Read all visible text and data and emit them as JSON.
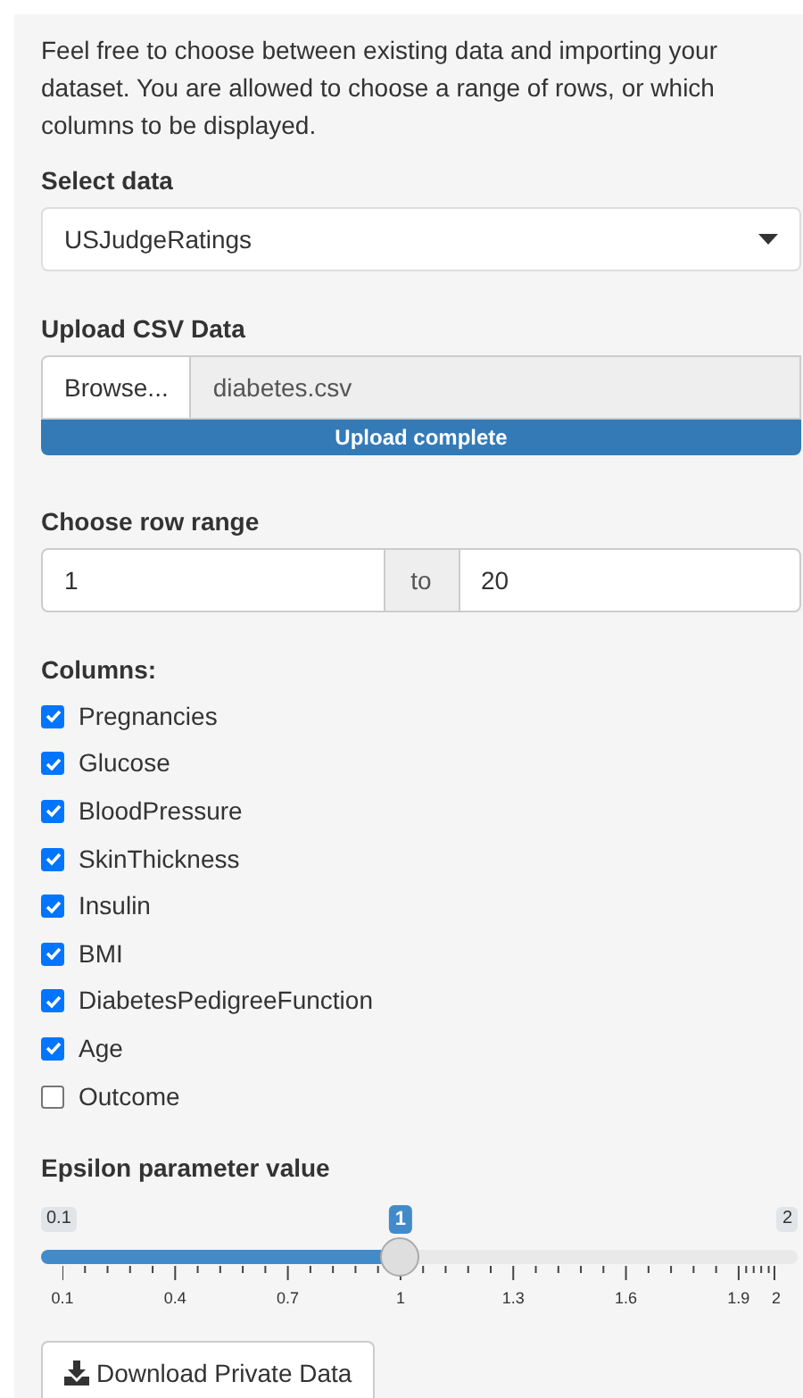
{
  "intro": "Feel free to choose between existing data and importing your dataset. You are allowed to choose a range of rows, or which columns to be displayed.",
  "select_data": {
    "label": "Select data",
    "value": "USJudgeRatings"
  },
  "upload": {
    "label": "Upload CSV Data",
    "button": "Browse...",
    "filename": "diabetes.csv",
    "progress": "Upload complete",
    "level": 1
  },
  "row_range": {
    "label": "Choose row range",
    "from": "1",
    "separator": "to",
    "to": "20"
  },
  "columns": {
    "label": "Columns:",
    "items": [
      {
        "label": "Pregnancies",
        "checked": true
      },
      {
        "label": "Glucose",
        "checked": true
      },
      {
        "label": "BloodPressure",
        "checked": true
      },
      {
        "label": "SkinThickness",
        "checked": true
      },
      {
        "label": "Insulin",
        "checked": true
      },
      {
        "label": "BMI",
        "checked": true
      },
      {
        "label": "DiabetesPedigreeFunction",
        "checked": true
      },
      {
        "label": "Age",
        "checked": true
      },
      {
        "label": "Outcome",
        "checked": false
      }
    ]
  },
  "epsilon": {
    "label": "Epsilon parameter value",
    "min_label": "0.1",
    "max_label": "2",
    "value_label": "1",
    "level": 0.4737,
    "ticks": [
      "0.1",
      "0.4",
      "0.7",
      "1",
      "1.3",
      "1.6",
      "1.9",
      "2"
    ]
  },
  "download_button": "Download Private Data"
}
